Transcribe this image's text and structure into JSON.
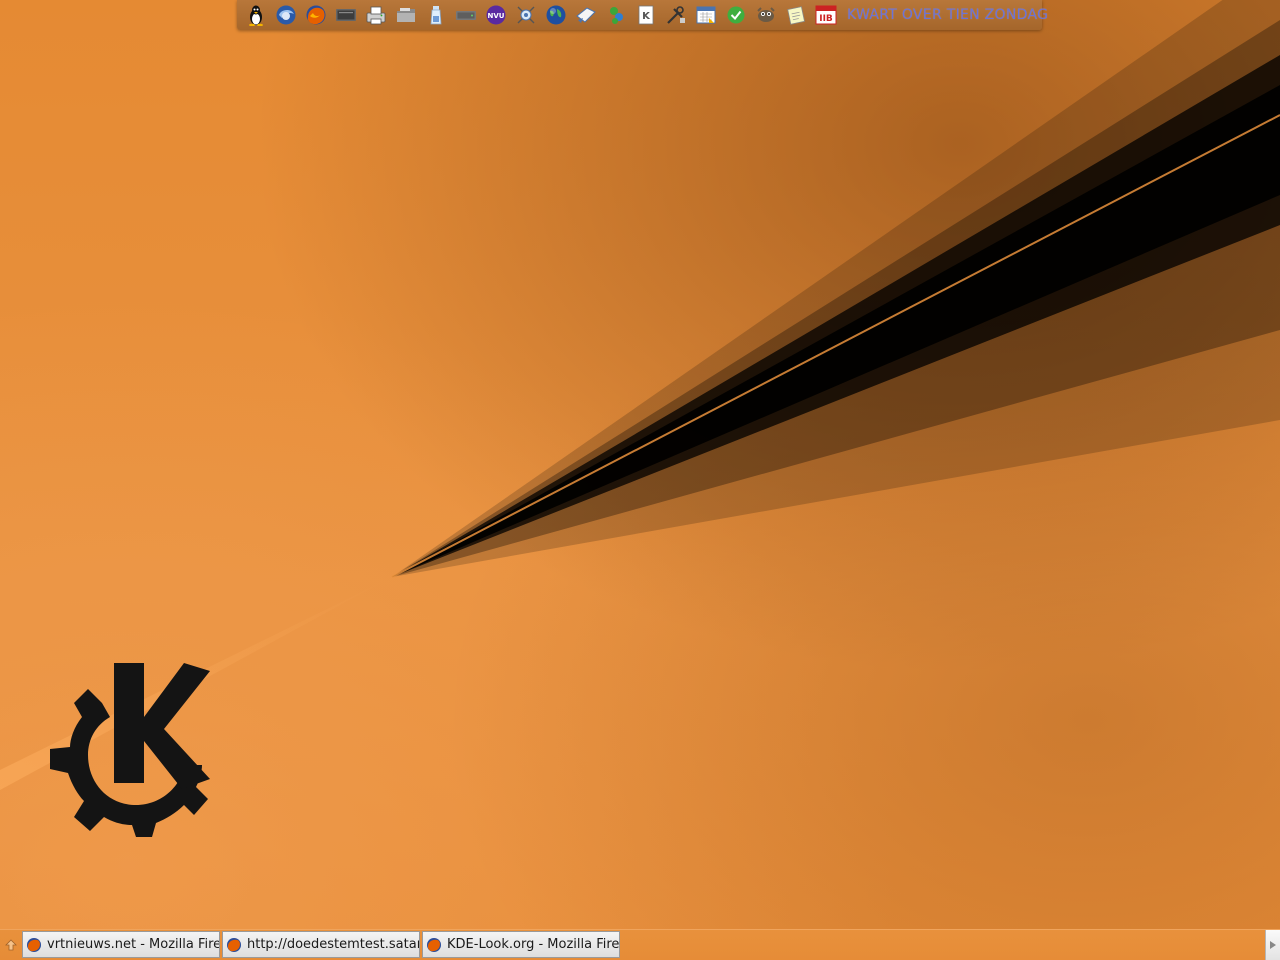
{
  "desktop": {
    "wallpaper": {
      "background_color": "#e8913c",
      "streak_color": "#000000",
      "logo": "kde-gear-logo"
    }
  },
  "top_panel": {
    "launchers": [
      {
        "name": "tux-icon"
      },
      {
        "name": "thunderbird-icon"
      },
      {
        "name": "firefox-icon"
      },
      {
        "name": "terminal-icon"
      },
      {
        "name": "printer-icon"
      },
      {
        "name": "folder-icon"
      },
      {
        "name": "bottle-icon"
      },
      {
        "name": "drive-icon"
      },
      {
        "name": "nvu-icon"
      },
      {
        "name": "network-icon"
      },
      {
        "name": "globe-icon"
      },
      {
        "name": "mail-icon"
      },
      {
        "name": "gaim-icon"
      },
      {
        "name": "kdict-icon"
      },
      {
        "name": "tools-icon"
      },
      {
        "name": "calendar-icon"
      },
      {
        "name": "check-icon"
      },
      {
        "name": "gimp-icon"
      },
      {
        "name": "notes-icon"
      },
      {
        "name": "imdb-icon"
      }
    ],
    "clock": {
      "text": "KWART OVER TIEN ZONDAG",
      "color": "#6a72d8"
    }
  },
  "taskbar": {
    "tasks": [
      {
        "label": "vrtnieuws.net - Mozilla Fire",
        "icon": "firefox-icon"
      },
      {
        "label": "http://doedestemtest.satan",
        "icon": "firefox-icon"
      },
      {
        "label": "KDE-Look.org - Mozilla Fire",
        "icon": "firefox-icon"
      }
    ]
  }
}
